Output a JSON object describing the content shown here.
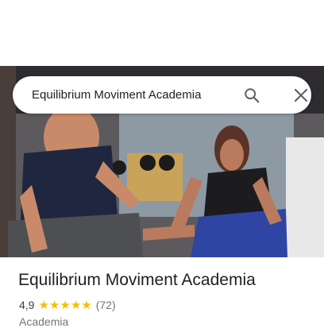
{
  "search": {
    "query": "Equilibrium Moviment Academia",
    "icon": "search-icon",
    "close_icon": "close-icon"
  },
  "place": {
    "name": "Equilibrium Moviment Academia",
    "rating": "4,9",
    "stars_filled": 5,
    "review_count": "(72)",
    "category": "Academia"
  },
  "colors": {
    "star": "#fbbc04",
    "text_primary": "#202124",
    "text_secondary": "#70757a",
    "icon": "#5f6368"
  }
}
